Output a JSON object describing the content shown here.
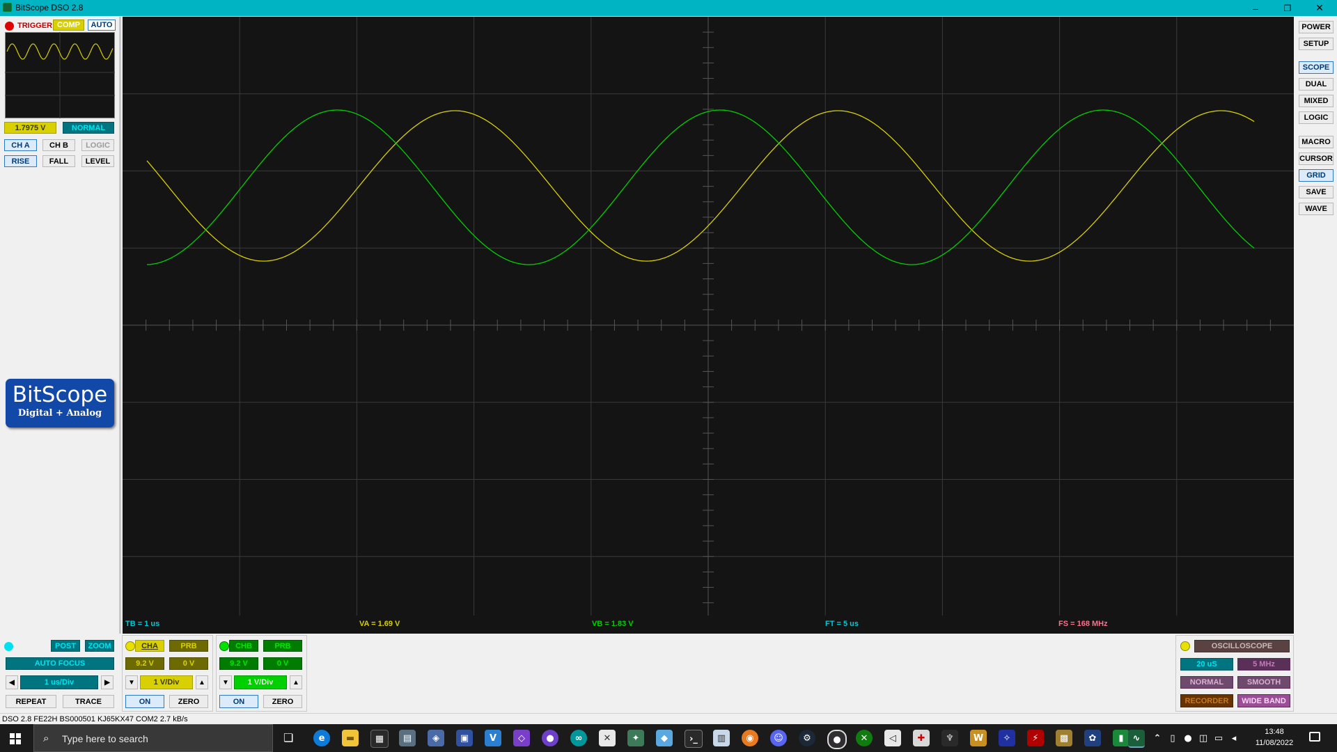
{
  "window": {
    "title": "BitScope DSO 2.8",
    "minimize": "–",
    "restore": "❐",
    "close": "✕"
  },
  "trigger": {
    "label": "TRIGGER",
    "comp": "COMP",
    "auto": "AUTO",
    "level_value": "1.7975 V",
    "mode": "NORMAL",
    "sources": [
      "CH A",
      "CH B",
      "LOGIC"
    ],
    "edges": [
      "RISE",
      "FALL",
      "LEVEL"
    ]
  },
  "logo": {
    "name": "BitScope",
    "tagline": "Digital + Analog"
  },
  "right_buttons": [
    "POWER",
    "SETUP",
    "SCOPE",
    "DUAL",
    "MIXED",
    "LOGIC",
    "MACRO",
    "CURSOR",
    "GRID",
    "SAVE",
    "WAVE"
  ],
  "readouts": {
    "tb": "TB = 1 us",
    "va": "VA = 1.69 V",
    "vb": "VB = 1.83 V",
    "ft": "FT = 5 us",
    "fs": "FS = 168 MHz"
  },
  "timebase_panel": {
    "post": "POST",
    "zoom": "ZOOM",
    "auto_focus": "AUTO FOCUS",
    "timebase": "1 us/Div",
    "repeat": "REPEAT",
    "trace": "TRACE"
  },
  "channel_a": {
    "name": "CHA",
    "probe": "PRB",
    "range": "9.2 V",
    "offset": "0 V",
    "scale": "1 V/Div",
    "on": "ON",
    "zero": "ZERO"
  },
  "channel_b": {
    "name": "CHB",
    "probe": "PRB",
    "range": "9.2 V",
    "offset": "0 V",
    "scale": "1 V/Div",
    "on": "ON",
    "zero": "ZERO"
  },
  "mode_panel": {
    "mode": "OSCILLOSCOPE",
    "duration": "20 uS",
    "rate": "5 MHz",
    "normal": "NORMAL",
    "smooth": "SMOOTH",
    "recorder": "RECORDER",
    "wideband": "WIDE BAND"
  },
  "status_bar": "DSO 2.8 FE22H BS000501 KJ65KX47 COM2 2.7 kB/s",
  "taskbar": {
    "search_placeholder": "Type here to search",
    "time": "13:48",
    "date": "11/08/2022"
  },
  "colors": {
    "channel_a": "#d8d000",
    "channel_b": "#00d000",
    "grid": "#3a3a3a",
    "screen": "#141414"
  },
  "waveforms": {
    "time_div_us": 1,
    "volts_div": 1,
    "channel_a_trace": "sine, about 1.9 cycles across the screen",
    "channel_b_trace": "sine, about 1.9 cycles across the screen"
  }
}
